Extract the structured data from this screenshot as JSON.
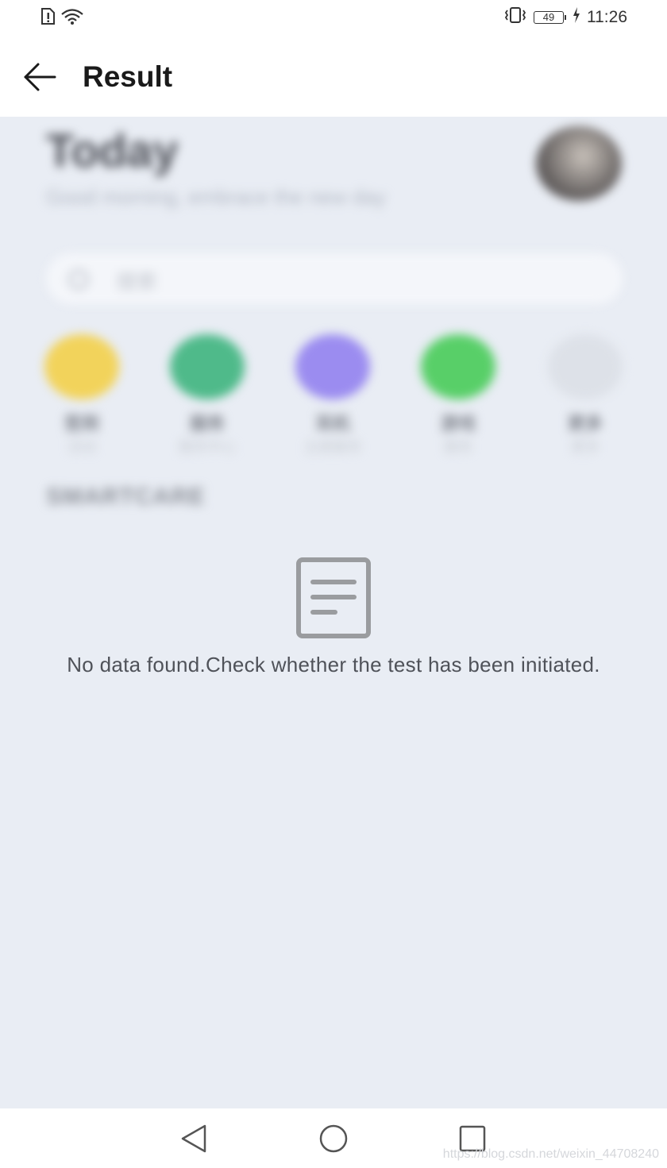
{
  "status_bar": {
    "time": "11:26",
    "battery_level": "49",
    "icons": [
      "sim-alert-icon",
      "wifi-icon",
      "vibrate-icon",
      "battery-icon",
      "charging-icon"
    ]
  },
  "app_bar": {
    "title": "Result",
    "back_icon": "arrow-left-icon"
  },
  "background": {
    "heading": "Today",
    "greeting": "Good morning, embrace the new day",
    "search_text": "搜索",
    "shortcuts": [
      {
        "label": "签到",
        "sub": "活动",
        "color": "#f2d35b"
      },
      {
        "label": "服务",
        "sub": "服务中心",
        "color": "#4fba8a"
      },
      {
        "label": "耳机",
        "sub": "主题服务",
        "color": "#9b8cf0"
      },
      {
        "label": "游戏",
        "sub": "服务",
        "color": "#58cf68"
      },
      {
        "label": "更多",
        "sub": "更多",
        "color": "#dde1e8"
      }
    ],
    "section_title": "SMARTCARE"
  },
  "empty_state": {
    "icon": "document-icon",
    "message": "No data found.Check whether the test has been initiated."
  },
  "nav_bar": {
    "buttons": [
      "back-triangle-icon",
      "home-circle-icon",
      "recents-square-icon"
    ]
  },
  "watermark": "https://blog.csdn.net/weixin_44708240",
  "colors": {
    "content_bg": "#e9edf4",
    "icon_gray": "#9a9c9f",
    "text_dark": "#1a1a1a"
  }
}
